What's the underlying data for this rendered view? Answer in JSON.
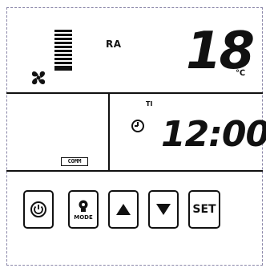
{
  "display": {
    "room_label": "RA",
    "temperature": "18",
    "temperature_unit": "℃",
    "comm_badge": "COMM",
    "timer_label": "TI",
    "time": "12:00"
  },
  "fan": {
    "icon": "fan-icon",
    "speed_bars_total": 10
  },
  "buttons": {
    "power": {
      "icon": "power-icon"
    },
    "mode": {
      "icon": "mode-icon",
      "label": "MODE"
    },
    "up": {
      "icon": "triangle-up-icon"
    },
    "down": {
      "icon": "triangle-down-icon"
    },
    "set": {
      "label": "SET"
    }
  }
}
